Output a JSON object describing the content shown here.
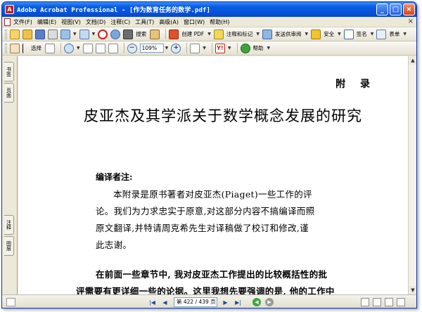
{
  "window": {
    "title": "Adobe Acrobat Professional - [作为数育任务的数学.pdf]",
    "controls": {
      "minimize": "_",
      "maximize": "□",
      "close": "×"
    }
  },
  "menubar": {
    "items": [
      "文件(F)",
      "编辑(E)",
      "视图(V)",
      "文档(D)",
      "注释(C)",
      "工具(T)",
      "高级(A)",
      "窗口(W)",
      "帮助(H)"
    ]
  },
  "toolbar1": {
    "search_label": "搜索",
    "create_pdf_label": "创建 PDF",
    "review_label": "注释和标记",
    "send_review_label": "发送供审阅",
    "secure_label": "安全",
    "sign_label": "签名",
    "forms_label": "表单"
  },
  "toolbar2": {
    "select_label": "选择",
    "zoom_value": "109%",
    "help_label": "帮助"
  },
  "navpanel": {
    "tab_bookmarks": "书签",
    "tab_pages": "页面",
    "tab_comments": "注释",
    "tab_layers": "图层"
  },
  "document": {
    "section_heading": "附  录",
    "title": "皮亚杰及其学派关于数学概念发展的研究",
    "editor_note_heading": "编译者注:",
    "editor_note_lines": [
      "本附录是原书著者对皮亚杰(Piaget)一些工作的评",
      "论。我们为力求忠实于原意,对这部分内容不搞编译而照",
      "原文翻译,并特请周克希先生对译稿做了校订和修改,谨",
      "此志谢。"
    ],
    "body_lines": [
      "在前面一些章节中, 我对皮亚杰工作提出的比较概括性的批",
      "评需要有更详细一些的论据。这里我想先要强调的是, 他的工作中"
    ]
  },
  "statusbar": {
    "page_indicator": "第 422 / 439 页"
  },
  "colors": {
    "titlebar_blue": "#0553d9",
    "chrome_beige": "#ece9d8",
    "acrobat_red": "#c8201a"
  }
}
